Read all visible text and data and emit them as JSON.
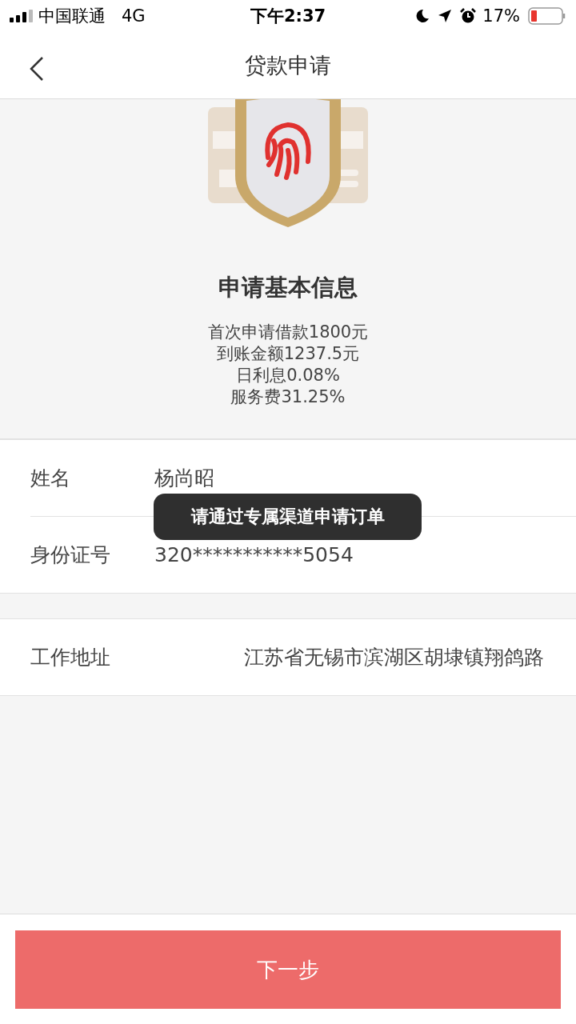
{
  "status_bar": {
    "carrier": "中国联通",
    "network": "4G",
    "time": "下午2:37",
    "battery": "17%"
  },
  "nav": {
    "title": "贷款申请"
  },
  "header": {
    "title": "申请基本信息",
    "lines": [
      "首次申请借款1800元",
      "到账金额1237.5元",
      "日利息0.08%",
      "服务费31.25%"
    ]
  },
  "sections": [
    {
      "rows": [
        {
          "label": "姓名",
          "value": "杨尚昭",
          "kind": "inline"
        },
        {
          "label": "身份证号",
          "value": "320***********5054",
          "kind": "inline"
        }
      ]
    },
    {
      "rows": [
        {
          "label": "工作地址",
          "value": "江苏省无锡市滨湖区胡埭镇翔鸽路",
          "kind": "trailing"
        }
      ]
    }
  ],
  "toast": "请通过专属渠道申请订单",
  "button": "下一步"
}
